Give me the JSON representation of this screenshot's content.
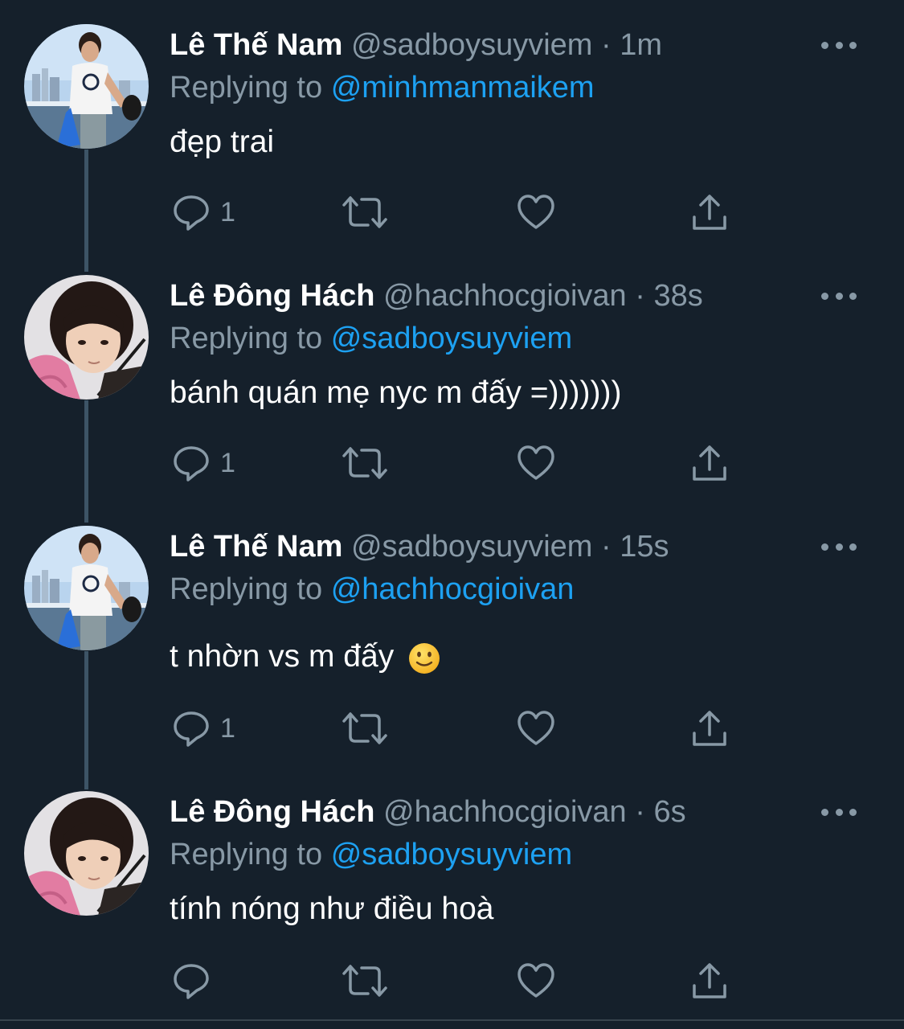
{
  "colors": {
    "background": "#15202b",
    "primary_text": "#ffffff",
    "secondary_text": "#8899a6",
    "mention": "#1da1f2",
    "thread_line": "#3d5466"
  },
  "icons": {
    "reply": "reply-icon",
    "retweet": "retweet-icon",
    "like": "heart-icon",
    "share": "share-icon",
    "more": "more-icon"
  },
  "tweets": [
    {
      "name": "Lê Thế Nam",
      "handle": "@sadboysuyviem",
      "separator": "·",
      "time": "1m",
      "replying_prefix": "Replying to",
      "replying_to": "@minhmanmaikem",
      "text": "đẹp trai",
      "reply_count": "1",
      "avatar": "man-on-boat-photo"
    },
    {
      "name": "Lê Đông Hách",
      "handle": "@hachhocgioivan",
      "separator": "·",
      "time": "38s",
      "replying_prefix": "Replying to",
      "replying_to": "@sadboysuyviem",
      "text": "bánh quán mẹ nyc m đấy =)))))))",
      "reply_count": "1",
      "avatar": "pink-hoodie-portrait"
    },
    {
      "name": "Lê Thế Nam",
      "handle": "@sadboysuyviem",
      "separator": "·",
      "time": "15s",
      "replying_prefix": "Replying to",
      "replying_to": "@hachhocgioivan",
      "text": "t nhờn vs m đấy",
      "emoji": "slightly-smiling-face",
      "reply_count": "1",
      "avatar": "man-on-boat-photo"
    },
    {
      "name": "Lê Đông Hách",
      "handle": "@hachhocgioivan",
      "separator": "·",
      "time": "6s",
      "replying_prefix": "Replying to",
      "replying_to": "@sadboysuyviem",
      "text": "tính nóng như điều hoà",
      "reply_count": "",
      "avatar": "pink-hoodie-portrait"
    }
  ]
}
